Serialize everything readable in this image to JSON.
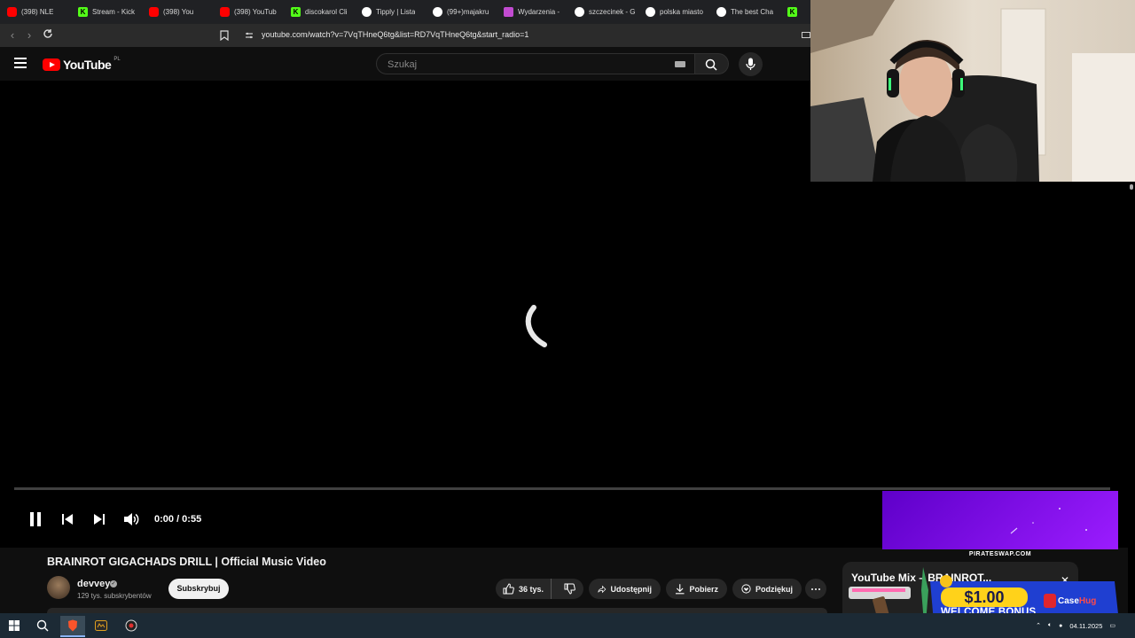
{
  "browser": {
    "tabs": [
      {
        "title": "(398) NLE",
        "favicon": "youtube-icon",
        "color": "#ff0000"
      },
      {
        "title": "Stream - Kick",
        "favicon": "kick-icon",
        "color": "#53fc18"
      },
      {
        "title": "(398) You",
        "favicon": "youtube-icon",
        "color": "#ff0000"
      },
      {
        "title": "(398) YouTub",
        "favicon": "youtube-icon",
        "color": "#ff0000"
      },
      {
        "title": "discokarol Cli",
        "favicon": "kick-icon",
        "color": "#53fc18"
      },
      {
        "title": "Tipply | Lista",
        "favicon": "tipply-icon",
        "color": "#ffffff"
      },
      {
        "title": "(99+)majakru",
        "favicon": "tiktok-icon",
        "color": "#ffffff"
      },
      {
        "title": "Wydarzenia -",
        "favicon": "event-icon",
        "color": "#c24bd1"
      },
      {
        "title": "szczecinek - G",
        "favicon": "google-icon",
        "color": "#ffffff"
      },
      {
        "title": "polska miasto",
        "favicon": "google-icon",
        "color": "#ffffff"
      },
      {
        "title": "The best Cha",
        "favicon": "diamond-icon",
        "color": "#ffffff"
      },
      {
        "title": "",
        "favicon": "kick-icon",
        "color": "#53fc18"
      }
    ],
    "url": "youtube.com/watch?v=7VqTHneQ6tg&list=RD7VqTHneQ6tg&start_radio=1"
  },
  "header": {
    "logo_text": "YouTube",
    "region": "PL",
    "search_placeholder": "Szukaj"
  },
  "player": {
    "time": "0:00 / 0:55",
    "state": "loading",
    "progress": 0,
    "ad_domain": "PIRATESWAP.COM"
  },
  "video": {
    "title": "BRAINROT GIGACHADS DRILL | Official Music Video",
    "channel": "devvey",
    "subscribers": "129 tys. subskrybentów",
    "subscribe_label": "Subskrybuj",
    "likes": "36 tys.",
    "share_label": "Udostępnij",
    "download_label": "Pobierz",
    "thanks_label": "Podziękuj"
  },
  "mix": {
    "title": "YouTube Mix – BRAINROT..."
  },
  "casino_ad": {
    "amount": "$1.00",
    "bonus_text": "WELCOME BONUS",
    "brand_a": "Case",
    "brand_b": "Hug"
  },
  "taskbar": {
    "date": "04.11.2025"
  },
  "colors": {
    "accent": "#ff0000",
    "background": "#0f0f0f",
    "ad_purple": "#7a0de0",
    "taskbar": "#1c2a35"
  }
}
